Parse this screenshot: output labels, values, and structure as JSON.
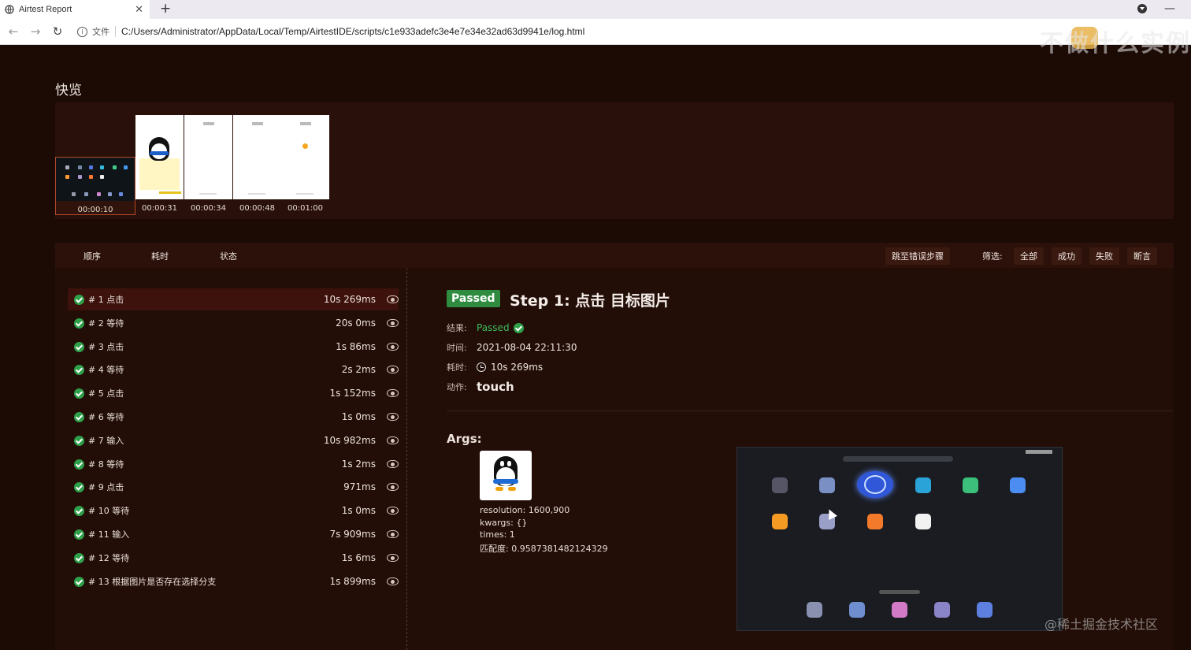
{
  "browser": {
    "tab_title": "Airtest Report",
    "tab_close": "✕",
    "new_tab": "+",
    "minimize": "—",
    "url_label": "文件",
    "url": "C:/Users/Administrator/AppData/Local/Temp/AirtestIDE/scripts/c1e933adefc3e4e7e34e32ad63d9941e/log.html"
  },
  "watermark_top": "不做什么实例",
  "quick_view": {
    "title": "快览",
    "thumbnails": [
      {
        "time": "00:00:10"
      },
      {
        "time": "00:00:31"
      },
      {
        "time": "00:00:34"
      },
      {
        "time": "00:00:48"
      },
      {
        "time": "00:01:00"
      }
    ]
  },
  "toolbar": {
    "col_order": "顺序",
    "col_duration": "耗时",
    "col_status": "状态",
    "jump_error": "跳至错误步骤",
    "filter_label": "筛选:",
    "filter_all": "全部",
    "filter_success": "成功",
    "filter_fail": "失败",
    "filter_assert": "断言"
  },
  "steps": [
    {
      "label": "# 1 点击",
      "time": "10s 269ms"
    },
    {
      "label": "# 2 等待",
      "time": "20s 0ms"
    },
    {
      "label": "# 3 点击",
      "time": "1s 86ms"
    },
    {
      "label": "# 4 等待",
      "time": "2s 2ms"
    },
    {
      "label": "# 5 点击",
      "time": "1s 152ms"
    },
    {
      "label": "# 6 等待",
      "time": "1s 0ms"
    },
    {
      "label": "# 7 输入",
      "time": "10s 982ms"
    },
    {
      "label": "# 8 等待",
      "time": "1s 2ms"
    },
    {
      "label": "# 9 点击",
      "time": "971ms"
    },
    {
      "label": "# 10 等待",
      "time": "1s 0ms"
    },
    {
      "label": "# 11 输入",
      "time": "7s 909ms"
    },
    {
      "label": "# 12 等待",
      "time": "1s 6ms"
    },
    {
      "label": "# 13 根据图片是否存在选择分支",
      "time": "1s 899ms"
    }
  ],
  "detail": {
    "badge": "Passed",
    "title": "Step 1: 点击 目标图片",
    "result_label": "结果:",
    "result_value": "Passed",
    "time_label": "时间:",
    "time_value": "2021-08-04 22:11:30",
    "duration_label": "耗时:",
    "duration_value": "10s 269ms",
    "action_label": "动作:",
    "action_value": "touch",
    "args_title": "Args:",
    "args": {
      "resolution": "resolution: 1600,900",
      "kwargs": "kwargs: {}",
      "times": "times: 1",
      "match": "匹配度:  0.9587381482124329"
    }
  },
  "watermark_bottom": "@稀土掘金技术社区",
  "colors": {
    "background": "#1c0a05",
    "panel": "#2a100a",
    "passed": "#2e8b3f",
    "active_row": "#3d120c"
  }
}
